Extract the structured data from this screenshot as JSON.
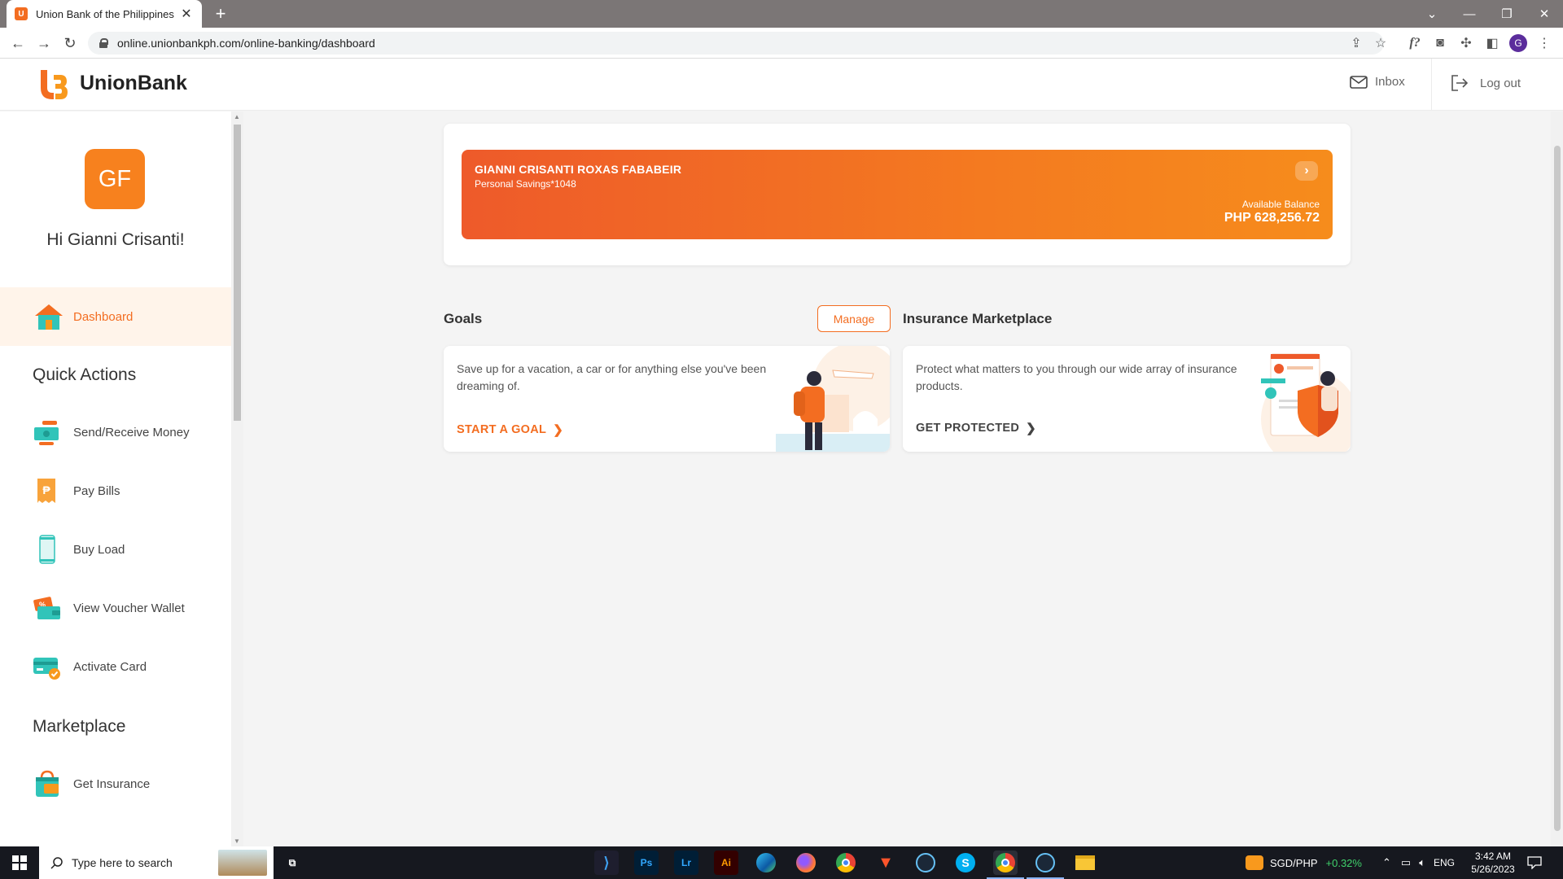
{
  "browser": {
    "tab_title": "Union Bank of the Philippines",
    "favicon_text": "U",
    "url": "online.unionbankph.com/online-banking/dashboard",
    "profile_initial": "G"
  },
  "header": {
    "brand": "UnionBank",
    "inbox_label": "Inbox",
    "logout_label": "Log out"
  },
  "sidebar": {
    "avatar_initials": "GF",
    "greeting": "Hi Gianni Crisanti!",
    "dashboard_label": "Dashboard",
    "quick_actions_title": "Quick Actions",
    "quick_actions": [
      {
        "label": "Send/Receive Money",
        "icon": "send-money-icon"
      },
      {
        "label": "Pay Bills",
        "icon": "pay-bills-icon"
      },
      {
        "label": "Buy Load",
        "icon": "buy-load-icon"
      },
      {
        "label": "View Voucher Wallet",
        "icon": "voucher-wallet-icon"
      },
      {
        "label": "Activate Card",
        "icon": "activate-card-icon"
      }
    ],
    "marketplace_title": "Marketplace",
    "marketplace": [
      {
        "label": "Get Insurance",
        "icon": "insurance-bag-icon"
      }
    ]
  },
  "account": {
    "name": "GIANNI CRISANTI ROXAS FABABEIR",
    "type": "Personal Savings*1048",
    "balance_label": "Available Balance",
    "balance": "PHP 628,256.72"
  },
  "goals": {
    "title": "Goals",
    "manage_label": "Manage",
    "text": "Save up for a vacation, a car or for anything else you've been dreaming of.",
    "cta": "START A GOAL"
  },
  "insurance": {
    "title": "Insurance Marketplace",
    "text": "Protect what matters to you through our wide array of insurance products.",
    "cta": "GET PROTECTED"
  },
  "taskbar": {
    "search_placeholder": "Type here to search",
    "ticker_pair": "SGD/PHP",
    "ticker_change": "+0.32%",
    "lang": "ENG",
    "time": "3:42 AM",
    "date": "5/26/2023",
    "apps": [
      "vscode",
      "photoshop",
      "lightroom",
      "illustrator",
      "edge",
      "firefox",
      "chrome",
      "brave",
      "steam",
      "skype",
      "chrome-active",
      "steam-2",
      "file-explorer"
    ]
  },
  "colors": {
    "brand_orange": "#f36d21",
    "card_gradient_start": "#ee5a2a",
    "card_gradient_end": "#f68c1c",
    "ticker_green": "#3fd16b"
  }
}
